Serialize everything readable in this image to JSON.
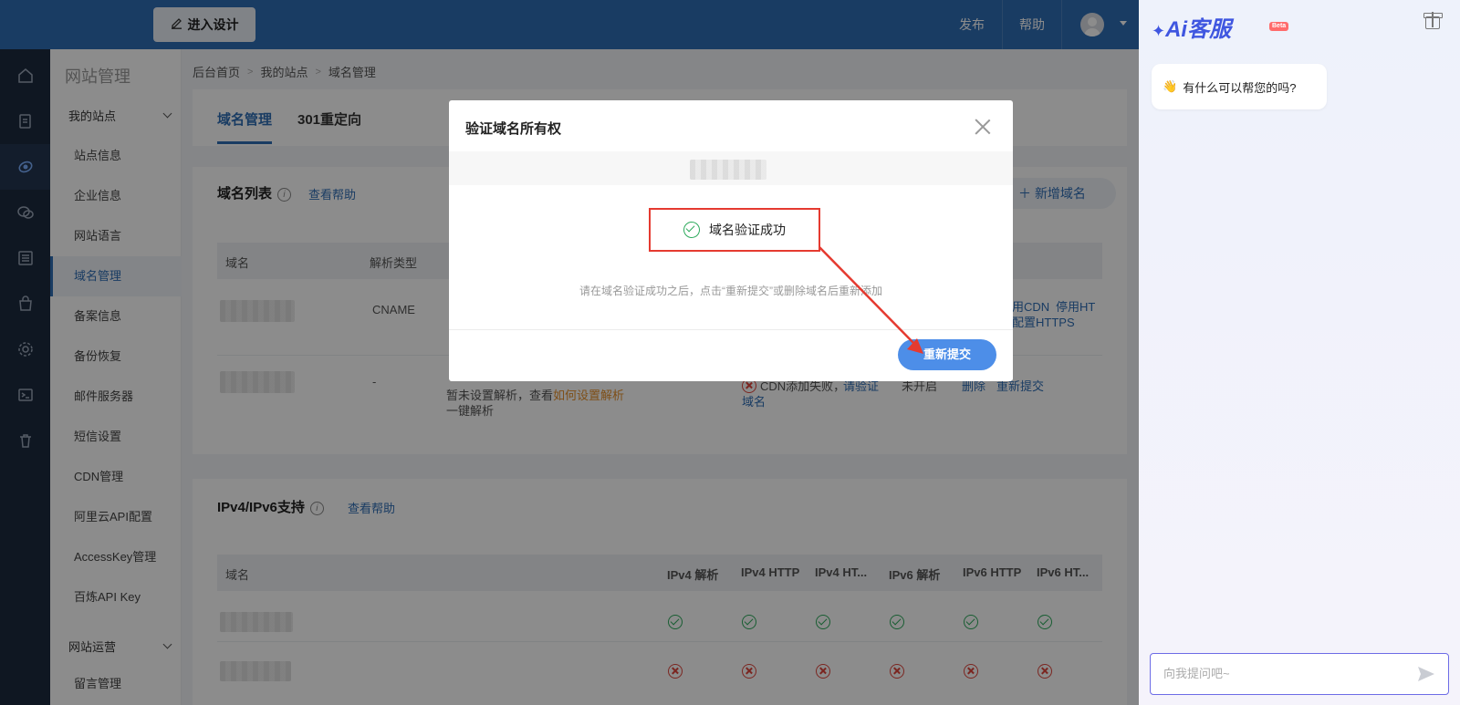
{
  "topbar": {
    "design_label": "进入设计",
    "publish": "发布",
    "help": "帮助"
  },
  "subnav": {
    "title": "网站管理",
    "group1": "我的站点",
    "items": [
      "站点信息",
      "企业信息",
      "网站语言",
      "域名管理",
      "备案信息",
      "备份恢复",
      "邮件服务器",
      "短信设置",
      "CDN管理",
      "阿里云API配置",
      "AccessKey管理",
      "百炼API Key"
    ],
    "group2": "网站运营",
    "group2_items": [
      "留言管理"
    ]
  },
  "breadcrumb": [
    "后台首页",
    "我的站点",
    "域名管理"
  ],
  "tabs": [
    "域名管理",
    "301重定向"
  ],
  "domain_card": {
    "title": "域名列表",
    "help": "查看帮助",
    "add": "新增域名",
    "headers": [
      "域名",
      "解析类型"
    ],
    "row1": {
      "type": "CNAME",
      "actions_a": "用CDN",
      "actions_b": "停用HT",
      "actions_c": "配置HTTPS"
    },
    "row2": {
      "type": "-",
      "note_prefix": "暂未设置解析，查看",
      "note_link": "如何设置解析",
      "one_click": "一键解析",
      "cdn_fail": "CDN添加失败，",
      "verify": "请验证",
      "domain": "域名",
      "status": "未开启",
      "del": "删除",
      "resubmit": "重新提交"
    }
  },
  "ip_card": {
    "title": "IPv4/IPv6支持",
    "help": "查看帮助",
    "headers": [
      "域名",
      "IPv4 解析",
      "IPv4 HTTP",
      "IPv4 HT...",
      "IPv6 解析",
      "IPv6 HTTP",
      "IPv6 HT..."
    ]
  },
  "modal": {
    "title": "验证域名所有权",
    "success": "域名验证成功",
    "hint": "请在域名验证成功之后，点击“重新提交”或删除域名后重新添加",
    "resubmit": "重新提交"
  },
  "ai": {
    "logo": "Ai客服",
    "beta": "Beta",
    "greeting": "有什么可以帮您的吗?",
    "placeholder": "向我提问吧~"
  },
  "colors": {
    "primary": "#2f6db5",
    "rail": "#1d2b3f",
    "success": "#2daa5c",
    "error": "#e0463c",
    "annotation": "#e53a30"
  }
}
